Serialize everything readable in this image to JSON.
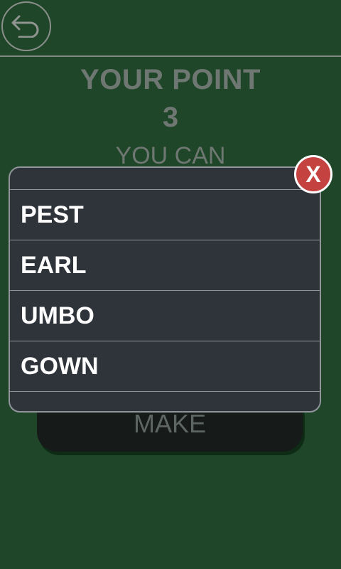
{
  "header": {
    "back_icon": "back-arrow-icon"
  },
  "score": {
    "title": "YOUR POINT",
    "value": "3",
    "subtitle": "YOU CAN"
  },
  "make_button": {
    "label": "MAKE"
  },
  "dialog": {
    "close_label": "X",
    "words": [
      {
        "text": "PEST"
      },
      {
        "text": "EARL"
      },
      {
        "text": "UMBO"
      },
      {
        "text": "GOWN"
      }
    ]
  },
  "colors": {
    "background": "#1f4628",
    "dialog_bg": "#2f343b",
    "close_red": "#c44341",
    "button_dark": "#161a19"
  }
}
